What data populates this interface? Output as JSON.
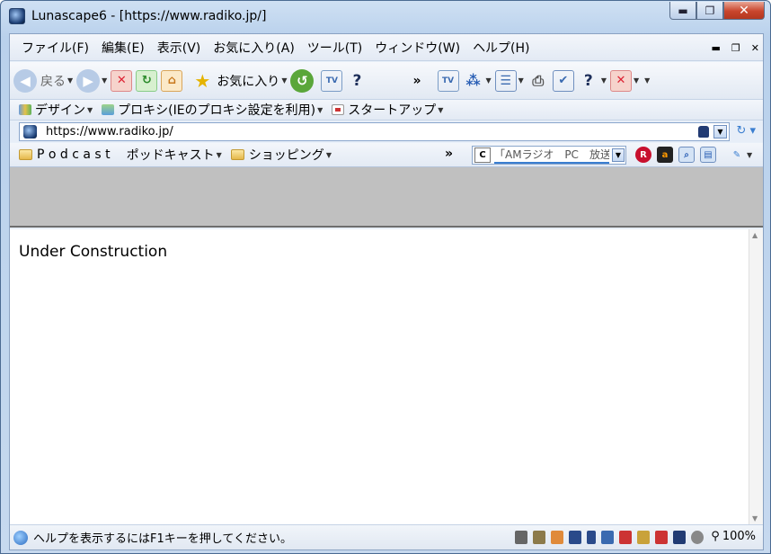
{
  "window": {
    "title": "Lunascape6 - [https://www.radiko.jp/]",
    "minimize": "▬",
    "maximize": "❐",
    "close": "✕"
  },
  "menu": {
    "items": [
      "ファイル(F)",
      "編集(E)",
      "表示(V)",
      "お気に入り(A)",
      "ツール(T)",
      "ウィンドウ(W)",
      "ヘルプ(H)"
    ],
    "mdi_min": "▬",
    "mdi_restore": "❐",
    "mdi_close": "✕"
  },
  "toolbar": {
    "back_label": "戻る",
    "favorites_label": "お気に入り",
    "chevron": "»"
  },
  "linkbar": {
    "design": "デザイン",
    "proxy": "プロキシ(IEのプロキシ設定を利用)",
    "startup": "スタートアップ"
  },
  "address": {
    "url": "https://www.radiko.jp/"
  },
  "favorites": {
    "podcast_en": "P o d c a s t",
    "podcast_jp": "ポッドキャスト",
    "shopping": "ショッピング",
    "chevron": "»",
    "search_text": "「AMラジオ　PC　放送",
    "engine": "C"
  },
  "content": {
    "text": "Under Construction"
  },
  "status": {
    "text": "ヘルプを表示するにはF1キーを押してください。",
    "zoom": "100%"
  },
  "colors": {
    "window_frame": "#b9d1ec",
    "toolbar_bg": "#e2e9f3",
    "gray_band": "#c0c0c0"
  }
}
